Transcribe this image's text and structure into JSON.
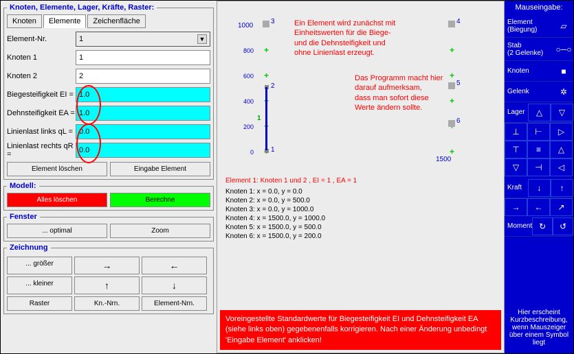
{
  "panel_main": {
    "legend": "Knoten, Elemente, Lager, Kräfte, Raster:"
  },
  "tabs": {
    "t0": "Knoten",
    "t1": "Elemente",
    "t2": "Zeichenfläche"
  },
  "fields": {
    "element_nr": {
      "label": "Element-Nr.",
      "value": "1"
    },
    "knoten1": {
      "label": "Knoten 1",
      "value": "1"
    },
    "knoten2": {
      "label": "Knoten 2",
      "value": "2"
    },
    "ei": {
      "label": "Biegesteifigkeit EI =",
      "value": "1.0"
    },
    "ea": {
      "label": "Dehnsteifigkeit EA =",
      "value": "1.0"
    },
    "ql": {
      "label": "Linienlast links qL =",
      "value": "0.0"
    },
    "qr": {
      "label": "Linienlast rechts qR =",
      "value": "0.0"
    }
  },
  "buttons": {
    "delete_elem": "Element löschen",
    "input_elem": "Eingabe Element",
    "delete_all": "Alles löschen",
    "compute": "Berechne",
    "optimal": "... optimal",
    "zoom": "Zoom"
  },
  "legends": {
    "model": "Modell:",
    "window": "Fenster",
    "drawing": "Zeichnung"
  },
  "draw": {
    "bigger": "... größer",
    "ar_r": "→",
    "ar_l": "←",
    "smaller": "... kleiner",
    "ar_u": "↑",
    "ar_d": "↓",
    "raster": "Raster",
    "knnrn": "Kn.-Nrn.",
    "elnrn": "Element-Nrn."
  },
  "right": {
    "title": "Mauseingabe:",
    "items": {
      "element": "Element\n(Biegung)",
      "stab": "Stab\n(2 Gelenke)",
      "knoten": "Knoten",
      "gelenk": "Gelenk",
      "lager": "Lager",
      "kraft": "Kraft",
      "moment": "Moment"
    },
    "hint": "Hier erscheint Kurzbeschreibung, wenn Mauszeiger über einem Symbol liegt"
  },
  "annot": {
    "a1": "Ein Element wird zunächst mit\nEinheitswerten für die Biege-\nund die Dehnsteifigkeit und\nohne Linienlast erzeugt.",
    "a2": "Das Programm macht hier\ndarauf aufmerksam,\ndass man sofort diese\nWerte ändern sollte."
  },
  "chart_data": {
    "type": "scatter",
    "xlabel": "",
    "ylabel": "",
    "xticks": [
      0,
      1500
    ],
    "yticks": [
      0,
      200,
      400,
      600,
      800,
      1000
    ],
    "yaxis_top": "1000",
    "knoten": [
      {
        "n": 1,
        "x": 0.0,
        "y": 0.0
      },
      {
        "n": 2,
        "x": 0.0,
        "y": 500.0
      },
      {
        "n": 3,
        "x": 0.0,
        "y": 1000.0
      },
      {
        "n": 4,
        "x": 1500.0,
        "y": 1000.0
      },
      {
        "n": 5,
        "x": 1500.0,
        "y": 500.0
      },
      {
        "n": 6,
        "x": 1500.0,
        "y": 200.0
      }
    ],
    "element": {
      "n": 1,
      "k1": 1,
      "k2": 2
    }
  },
  "info": {
    "title": "Element 1:   Knoten 1 und 2 ,   EI = 1 ,  EA = 1",
    "lines": [
      "Knoten 1:  x = 0.0,   y = 0.0",
      "Knoten 2:  x = 0.0,   y = 500.0",
      "Knoten 3:  x = 0.0,   y = 1000.0",
      "Knoten 4:  x = 1500.0,   y = 1000.0",
      "Knoten 5:  x = 1500.0,   y = 500.0",
      "Knoten 6:  x = 1500.0,   y = 200.0"
    ]
  },
  "warn": "Voreingestellte Standardwerte für Biegesteifigkeit EI und Dehnsteifigkeit EA (siehe links oben) gegebenenfalls korrigieren. Nach einer Änderung unbedingt 'Eingabe Element' anklicken!"
}
